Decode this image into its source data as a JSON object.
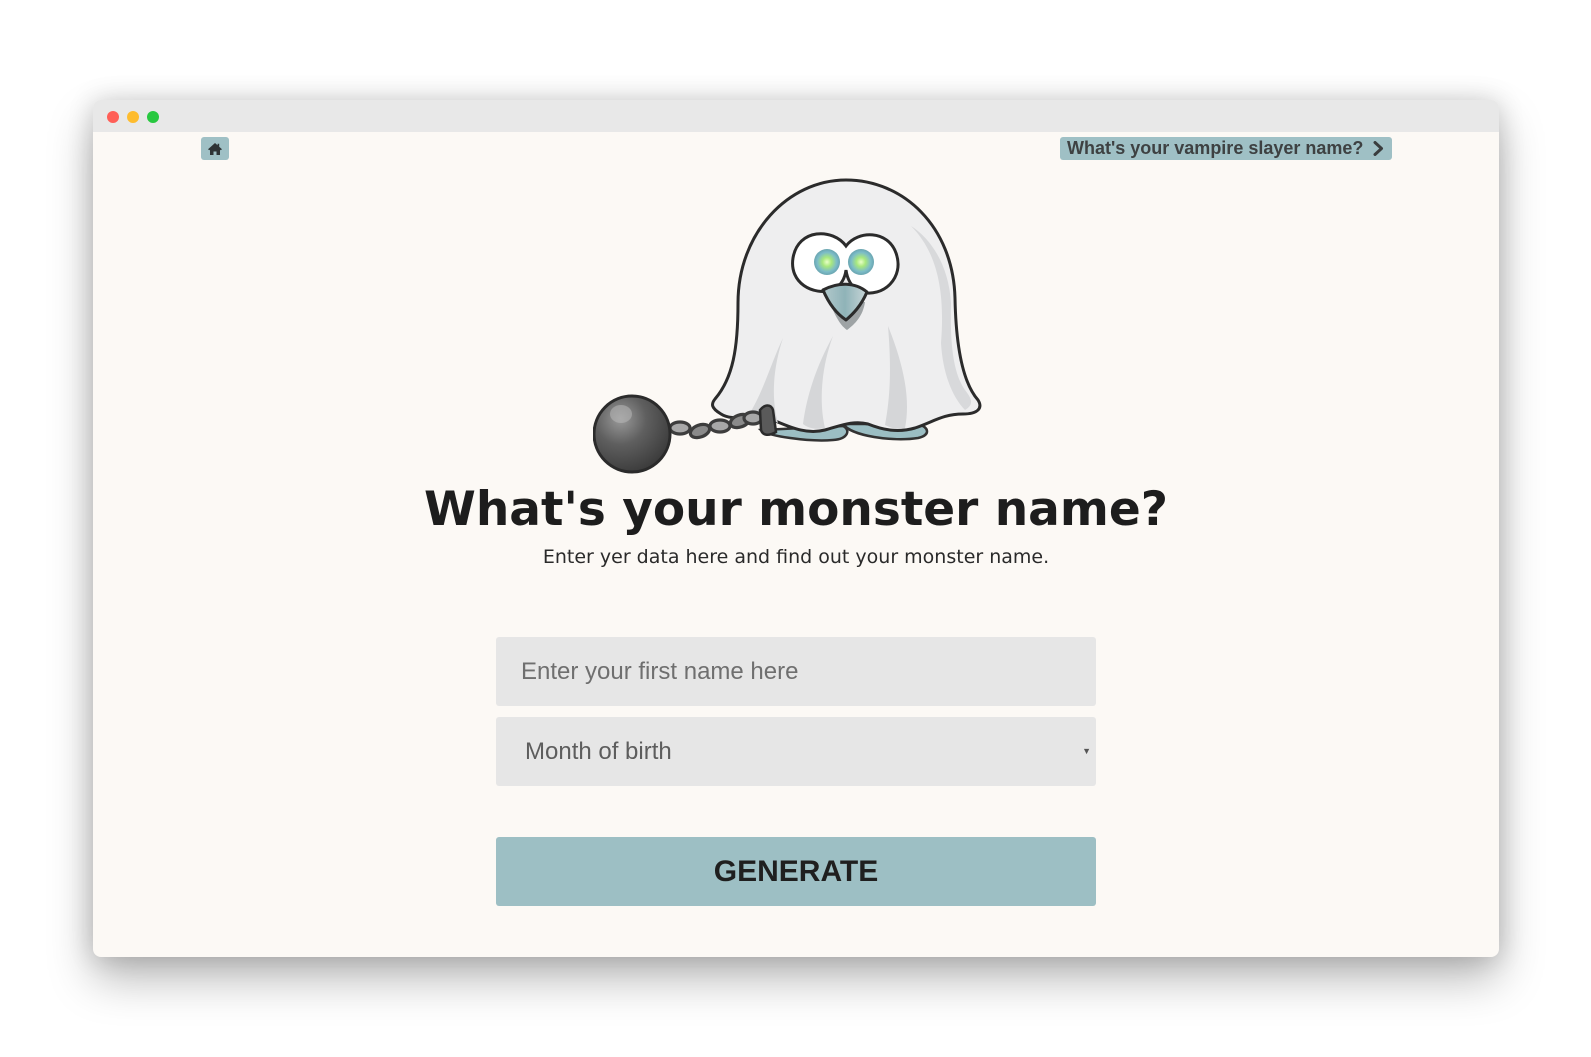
{
  "window": {
    "controls": [
      "close",
      "minimize",
      "maximize"
    ]
  },
  "nav": {
    "home_icon": "home-icon",
    "next_label": "What's your vampire slayer name?",
    "next_icon": "chevron-right-icon"
  },
  "hero": {
    "illustration": "ghost-with-ball-and-chain",
    "title": "What's your monster name?",
    "subtitle": "Enter yer data here and find out your monster name."
  },
  "form": {
    "name_placeholder": "Enter your first name here",
    "name_value": "",
    "month_selected": "Month of birth",
    "generate_label": "GENERATE"
  },
  "colors": {
    "accent": "#9fc0c5",
    "page_bg": "#fcf9f5",
    "field_bg": "#e6e6e6",
    "title_text": "#1d1d1d"
  }
}
